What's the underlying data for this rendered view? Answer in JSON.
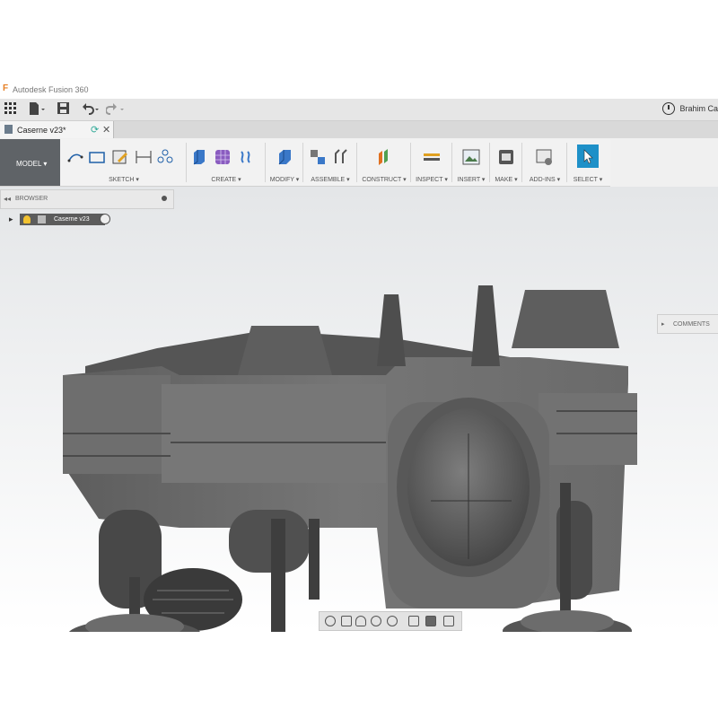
{
  "window": {
    "title": "Autodesk Fusion 360",
    "user": "Brahim Ca"
  },
  "document_tab": {
    "name": "Caserne v23*"
  },
  "toolbar": {
    "workspace": "MODEL ▾",
    "groups": [
      {
        "label": "SKETCH ▾"
      },
      {
        "label": "CREATE ▾"
      },
      {
        "label": "MODIFY ▾"
      },
      {
        "label": "ASSEMBLE ▾"
      },
      {
        "label": "CONSTRUCT ▾"
      },
      {
        "label": "INSPECT ▾"
      },
      {
        "label": "INSERT ▾"
      },
      {
        "label": "MAKE ▾"
      },
      {
        "label": "ADD-INS ▾"
      },
      {
        "label": "SELECT ▾"
      }
    ]
  },
  "browser": {
    "title": "BROWSER",
    "root_node": "Caserne v23"
  },
  "comments": {
    "title": "COMMENTS"
  },
  "icons": [
    "grid-icon",
    "file-icon",
    "save-icon",
    "undo-icon",
    "redo-icon",
    "clock-icon",
    "orbit-icon",
    "pan-icon",
    "zoom-icon",
    "display-icon",
    "grid-view-icon"
  ],
  "colors": {
    "accent": "#1e90c8",
    "toolbar_bg": "#f2f2f2",
    "model_btn": "#5f6367",
    "model_body": "#6a6a6a"
  }
}
